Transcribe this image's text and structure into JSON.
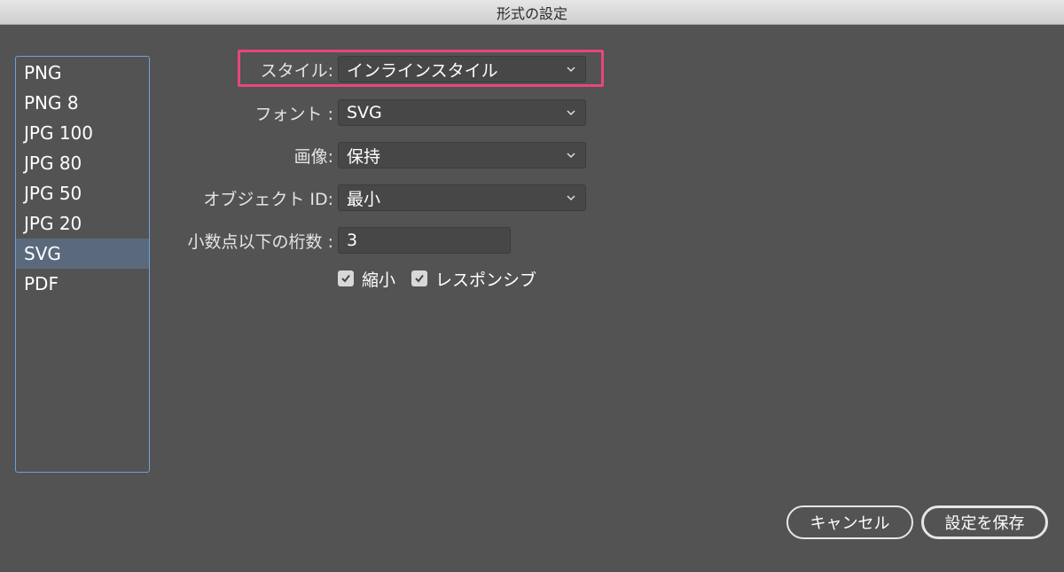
{
  "window": {
    "title": "形式の設定"
  },
  "formats": [
    {
      "label": "PNG",
      "selected": false
    },
    {
      "label": "PNG 8",
      "selected": false
    },
    {
      "label": "JPG 100",
      "selected": false
    },
    {
      "label": "JPG 80",
      "selected": false
    },
    {
      "label": "JPG 50",
      "selected": false
    },
    {
      "label": "JPG 20",
      "selected": false
    },
    {
      "label": "SVG",
      "selected": true
    },
    {
      "label": "PDF",
      "selected": false
    }
  ],
  "settings": {
    "style": {
      "label": "スタイル:",
      "value": "インラインスタイル"
    },
    "font": {
      "label": "フォント :",
      "value": "SVG"
    },
    "image": {
      "label": "画像:",
      "value": "保持"
    },
    "object_id": {
      "label": "オブジェクト ID:",
      "value": "最小"
    },
    "decimal": {
      "label": "小数点以下の桁数 :",
      "value": "3"
    }
  },
  "checkboxes": {
    "minify": {
      "label": "縮小",
      "checked": true
    },
    "responsive": {
      "label": "レスポンシブ",
      "checked": true
    }
  },
  "buttons": {
    "cancel": "キャンセル",
    "save": "設定を保存"
  },
  "colors": {
    "highlight": "#e8467c",
    "selection": "#5a6a7c",
    "list_border": "#6fa0e0"
  }
}
